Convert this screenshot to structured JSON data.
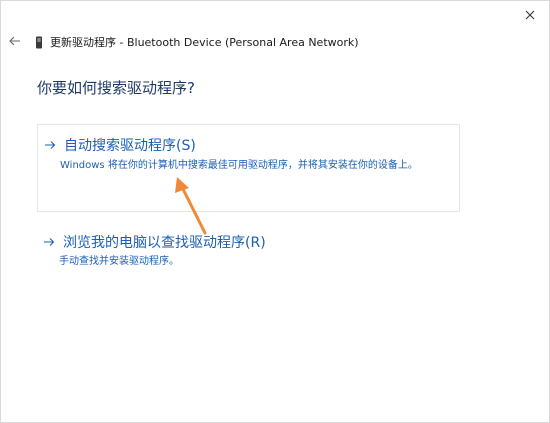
{
  "window": {
    "title": "更新驱动程序 - Bluetooth Device (Personal Area Network)"
  },
  "heading": "你要如何搜索驱动程序?",
  "options": [
    {
      "title": "自动搜索驱动程序(S)",
      "description": "Windows 将在你的计算机中搜索最佳可用驱动程序，并将其安装在你的设备上。"
    },
    {
      "title": "浏览我的电脑以查找驱动程序(R)",
      "description": "手动查找并安装驱动程序。"
    }
  ],
  "colors": {
    "link": "#1a5fb4",
    "heading": "#1f3a66",
    "annotation_arrow": "#f0883a"
  },
  "icons": {
    "close": "close-icon",
    "back": "back-arrow-icon",
    "device": "bluetooth-device-icon",
    "option_arrow": "right-arrow-icon"
  }
}
